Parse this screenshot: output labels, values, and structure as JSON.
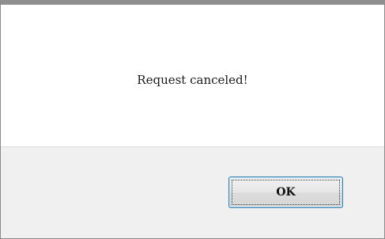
{
  "dialog": {
    "message": "Request canceled!",
    "ok_label": "OK"
  }
}
